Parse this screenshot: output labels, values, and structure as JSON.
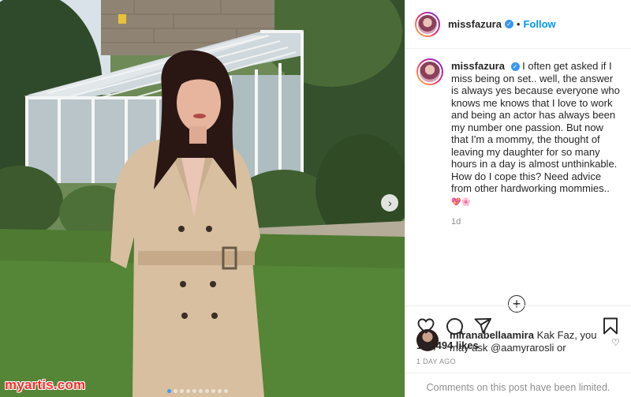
{
  "post": {
    "username": "missfazura",
    "follow_label": "Follow",
    "separator": "•",
    "caption": "I often get asked if I miss being on set.. well, the answer is always yes because everyone who knows me knows that I love to work and being an actor has always been my number one passion. But now that I'm a mommy, the thought of leaving my daughter for so many hours in a day is almost unthinkable. How do I cope this? Need advice from other hardworking mommies..",
    "caption_emoji": "💖🌸",
    "age": "1d",
    "more_comments_icon": "plus-circle-icon"
  },
  "comment": {
    "username": "miranabellaamira",
    "text": "Kak Faz, you may ask @aamyrarosli or"
  },
  "actions": {
    "likes": "114,494 likes",
    "date": "1 DAY AGO",
    "comments_limited": "Comments on this post have been limited."
  },
  "photo": {
    "watermark": "myartis.com",
    "carousel_active_index": 0,
    "carousel_count": 10
  },
  "colors": {
    "accent": "#0095f6",
    "verified": "#3897f0",
    "muted": "#8e8e8e"
  }
}
